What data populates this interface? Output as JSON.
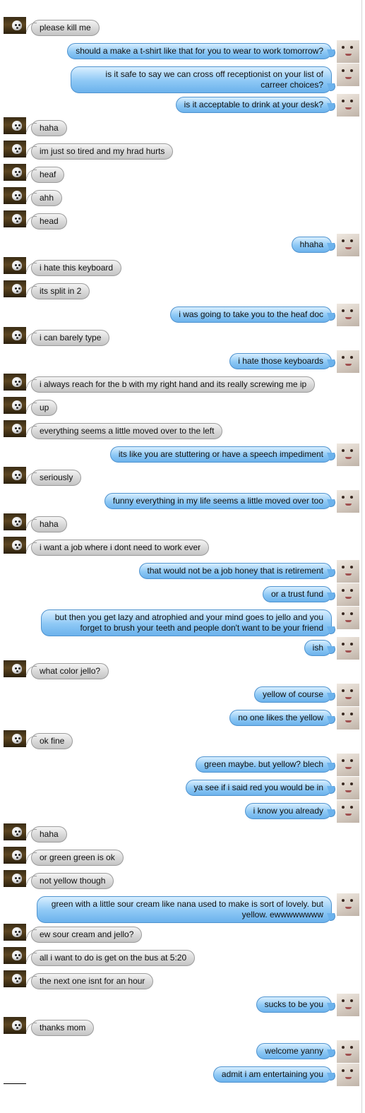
{
  "messages": [
    {
      "side": "left",
      "text": "please kill me"
    },
    {
      "side": "right",
      "text": "should a make a t-shirt like that for you to wear to work tomorrow?"
    },
    {
      "side": "right",
      "text": "is it safe to say we can cross off receptionist on your list of carreer choices?"
    },
    {
      "side": "right",
      "text": "is it acceptable to drink at your desk?"
    },
    {
      "side": "left",
      "text": "haha"
    },
    {
      "side": "left",
      "text": "im just so tired and my hrad hurts"
    },
    {
      "side": "left",
      "text": "heaf"
    },
    {
      "side": "left",
      "text": "ahh"
    },
    {
      "side": "left",
      "text": "head"
    },
    {
      "side": "right",
      "text": "hhaha"
    },
    {
      "side": "left",
      "text": "i hate this keyboard"
    },
    {
      "side": "left",
      "text": "its split in 2"
    },
    {
      "side": "right",
      "text": "i was going to take you to the heaf doc"
    },
    {
      "side": "left",
      "text": "i can barely type"
    },
    {
      "side": "right",
      "text": "i hate those keyboards"
    },
    {
      "side": "left",
      "text": "i always reach for the b with my right hand and its really screwing me ip"
    },
    {
      "side": "left",
      "text": "up"
    },
    {
      "side": "left",
      "text": "everything seems a little moved over to the left"
    },
    {
      "side": "right",
      "text": "its like you are stuttering or have a speech impediment"
    },
    {
      "side": "left",
      "text": "seriously"
    },
    {
      "side": "right",
      "text": "funny everything in my life seems a little moved over too"
    },
    {
      "side": "left",
      "text": "haha"
    },
    {
      "side": "left",
      "text": "i want a job where i dont need to work ever"
    },
    {
      "side": "right",
      "text": "that would not be a job honey that is retirement"
    },
    {
      "side": "right",
      "text": "or a trust fund"
    },
    {
      "side": "right",
      "text": "but then you get lazy and atrophied and your mind goes to jello and you forget to brush your teeth and people don't want to be your friend"
    },
    {
      "side": "right",
      "text": "ish"
    },
    {
      "side": "left",
      "text": "what color jello?"
    },
    {
      "side": "right",
      "text": "yellow of course"
    },
    {
      "side": "right",
      "text": "no one likes the yellow"
    },
    {
      "side": "left",
      "text": "ok fine"
    },
    {
      "side": "right",
      "text": "green maybe. but yellow? blech"
    },
    {
      "side": "right",
      "text": "ya see if i said red you would be in"
    },
    {
      "side": "right",
      "text": "i know you already"
    },
    {
      "side": "left",
      "text": "haha"
    },
    {
      "side": "left",
      "text": "or green green is ok"
    },
    {
      "side": "left",
      "text": "not yellow though"
    },
    {
      "side": "right",
      "text": "green with a little sour cream like nana used to make is sort of lovely. but yellow. ewwwwwwww"
    },
    {
      "side": "left",
      "text": "ew sour cream and jello?"
    },
    {
      "side": "left",
      "text": "all i want to do is get on the bus at 5:20"
    },
    {
      "side": "left",
      "text": "the next one isnt for an hour"
    },
    {
      "side": "right",
      "text": "sucks to be you"
    },
    {
      "side": "left",
      "text": "thanks mom"
    },
    {
      "side": "right",
      "text": "welcome yanny"
    },
    {
      "side": "right",
      "text": "admit i am entertaining you"
    }
  ]
}
